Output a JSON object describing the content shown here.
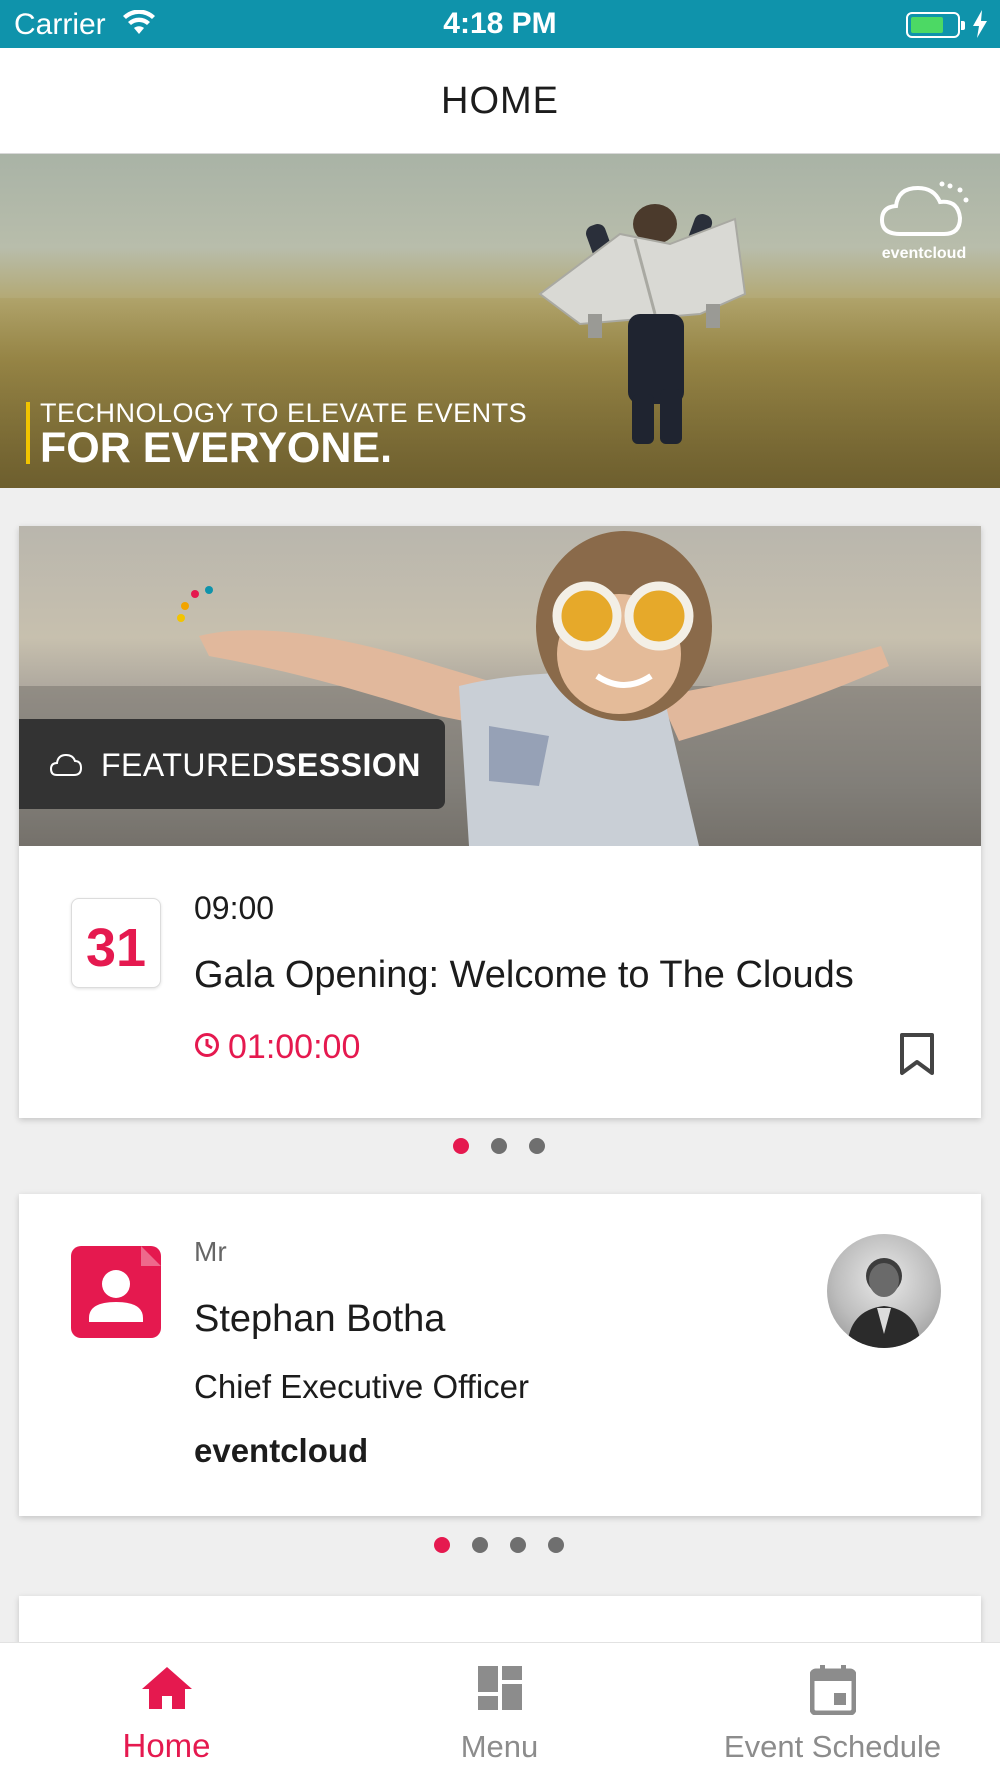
{
  "status_bar": {
    "carrier": "Carrier",
    "time": "4:18 PM"
  },
  "header": {
    "title": "HOME"
  },
  "hero": {
    "tagline_small": "TECHNOLOGY TO ELEVATE EVENTS",
    "tagline_big": "FOR EVERYONE.",
    "logo_text": "eventcloud"
  },
  "featured": {
    "label_light": "FEATURED",
    "label_bold": "SESSION",
    "day": "31",
    "time": "09:00",
    "title": "Gala Opening: Welcome to The Clouds",
    "duration": "01:00:00",
    "pager": {
      "count": 3,
      "active_index": 0
    }
  },
  "speaker": {
    "prefix": "Mr",
    "name": "Stephan Botha",
    "role": "Chief Executive Officer",
    "company": "eventcloud",
    "pager": {
      "count": 4,
      "active_index": 0
    }
  },
  "tabs": [
    {
      "label": "Home",
      "icon": "home-icon",
      "active": true
    },
    {
      "label": "Menu",
      "icon": "dashboard-icon",
      "active": false
    },
    {
      "label": "Event Schedule",
      "icon": "calendar-icon",
      "active": false
    }
  ],
  "colors": {
    "accent": "#e5194f",
    "status_bar": "#0f93ab",
    "inactive": "#8c8c8c",
    "tagline_accent": "#f2c400"
  }
}
